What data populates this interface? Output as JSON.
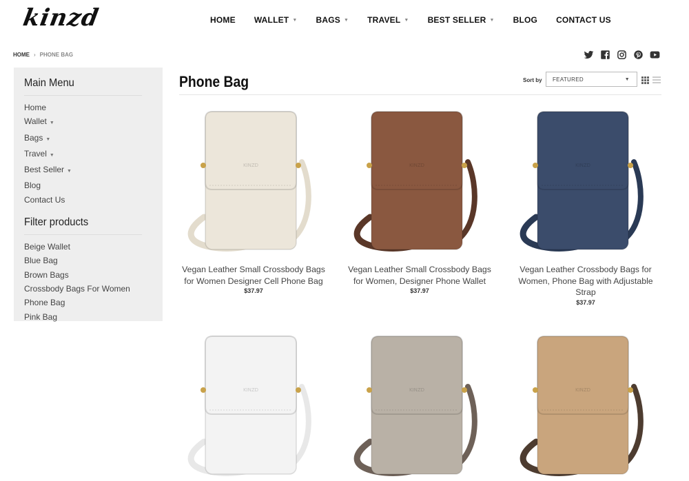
{
  "brand": {
    "logo": "kinzd"
  },
  "nav": [
    {
      "label": "HOME",
      "dropdown": false
    },
    {
      "label": "WALLET",
      "dropdown": true
    },
    {
      "label": "BAGS",
      "dropdown": true
    },
    {
      "label": "TRAVEL",
      "dropdown": true
    },
    {
      "label": "BEST SELLER",
      "dropdown": true
    },
    {
      "label": "BLOG",
      "dropdown": false
    },
    {
      "label": "CONTACT US",
      "dropdown": false
    }
  ],
  "breadcrumb": {
    "home": "HOME",
    "separator": "›",
    "current": "PHONE BAG"
  },
  "social_icons": [
    "twitter-icon",
    "facebook-icon",
    "instagram-icon",
    "pinterest-icon",
    "youtube-icon"
  ],
  "sidebar": {
    "main_menu_title": "Main Menu",
    "main_menu": [
      {
        "label": "Home",
        "dropdown": false
      },
      {
        "label": "Wallet",
        "dropdown": true
      },
      {
        "label": "Bags",
        "dropdown": true
      },
      {
        "label": "Travel",
        "dropdown": true
      },
      {
        "label": "Best Seller",
        "dropdown": true
      },
      {
        "label": "Blog",
        "dropdown": false
      },
      {
        "label": "Contact Us",
        "dropdown": false
      }
    ],
    "filter_title": "Filter products",
    "filters": [
      "Beige Wallet",
      "Blue Bag",
      "Brown Bags",
      "Crossbody Bags For Women",
      "Phone Bag",
      "Pink Bag"
    ]
  },
  "collection": {
    "title": "Phone Bag",
    "sort_label": "Sort by",
    "sort_value": "FEATURED"
  },
  "products": [
    {
      "name": "Vegan Leather Small Crossbody Bags for Women Designer Cell Phone Bag",
      "price": "$37.97",
      "color": "#ece6da",
      "strap": "#e3dccd"
    },
    {
      "name": "Vegan Leather Small Crossbody Bags for Women, Designer Phone Wallet",
      "price": "$37.97",
      "color": "#8a5840",
      "strap": "#5a3728"
    },
    {
      "name": "Vegan Leather Crossbody Bags for Women, Phone Bag with Adjustable Strap",
      "price": "$37.97",
      "color": "#3b4c6b",
      "strap": "#2a3a55"
    },
    {
      "name": "",
      "price": "",
      "color": "#f3f3f3",
      "strap": "#e8e8e8"
    },
    {
      "name": "",
      "price": "",
      "color": "#b9b1a6",
      "strap": "#6e6158"
    },
    {
      "name": "",
      "price": "",
      "color": "#c9a57d",
      "strap": "#4d3c30"
    }
  ]
}
